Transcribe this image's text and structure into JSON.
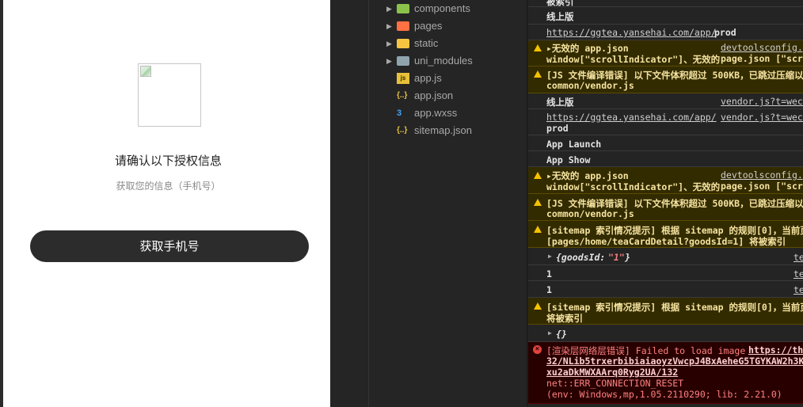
{
  "simulator": {
    "title": "请确认以下授权信息",
    "subtitle": "获取您的信息（手机号）",
    "button": "获取手机号"
  },
  "tree": [
    {
      "label": "components",
      "icon": "components-folder-icon",
      "arrow": "▶",
      "color": "#8bc34a"
    },
    {
      "label": "pages",
      "icon": "pages-folder-icon",
      "arrow": "▶",
      "color": "#ff7043"
    },
    {
      "label": "static",
      "icon": "static-folder-icon",
      "arrow": "▶",
      "color": "#f5c542"
    },
    {
      "label": "uni_modules",
      "icon": "folder-icon",
      "arrow": "▶",
      "color": "#90a4ae"
    },
    {
      "label": "app.js",
      "icon": "js-file-icon",
      "arrow": "",
      "color": "#e8c13a"
    },
    {
      "label": "app.json",
      "icon": "json-file-icon",
      "arrow": "",
      "color": "#e8c13a"
    },
    {
      "label": "app.wxss",
      "icon": "css-file-icon",
      "arrow": "",
      "color": "#42a5f5"
    },
    {
      "label": "sitemap.json",
      "icon": "json-file-icon",
      "arrow": "",
      "color": "#e8c13a"
    }
  ],
  "console": {
    "r0": "被索引",
    "r1": "线上版",
    "r2_link": "https://ggtea.yansehai.com/app/",
    "r2_text": "prod",
    "r3_a": "▸无效的 app.json",
    "r3_b": "window[\"scrollIndicator\"]、无效的",
    "r3_src1": "devtoolsconfig.j",
    "r3_src2": "page.json [\"scr",
    "r4_a": "[JS 文件编译错误] 以下文件体积超过 500KB，已跳过压缩以",
    "r4_b": "common/vendor.js",
    "r5": "线上版",
    "r5_src": "vendor.js?t=wech",
    "r6_link": "https://ggtea.yansehai.com/app/",
    "r6_text": "prod",
    "r6_src": "vendor.js?t=wech",
    "r7": "App Launch",
    "r8": "App Show",
    "r9_a": "▸无效的 app.json",
    "r9_b": "window[\"scrollIndicator\"]、无效的",
    "r9_src1": "devtoolsconfig.j",
    "r9_src2": "page.json [\"scr",
    "r10_a": "[JS 文件编译错误] 以下文件体积超过 500KB，已跳过压缩以",
    "r10_b": "common/vendor.js",
    "r11_a": "[sitemap 索引情况提示] 根据 sitemap 的规则[0]，当前页",
    "r11_b": "[pages/home/teaCardDetail?goodsId=1] 将被索引",
    "r12_key": "{goodsId: ",
    "r12_val": "\"1\"",
    "r12_end": "}",
    "r12_src": "te",
    "r13": "1",
    "r13_src": "te",
    "r14": "1",
    "r14_src": "te",
    "r15_a": "[sitemap 索引情况提示] 根据 sitemap 的规则[0]，当前页",
    "r15_b": "将被索引",
    "r16": "{}",
    "r17_a": "[渲染层网络层错误] Failed to load image",
    "r17_link": "https://thi",
    "r17_b": "32/NLib5trxerbibiaiaoyzVwcpJ4BxAeheG5TGYKAW2h3Kia",
    "r17_c": "xu2aDkMWXAArq0Ryg2UA/132",
    "r17_d": "net::ERR_CONNECTION_RESET",
    "r17_e": "(env: Windows,mp,1.05.2110290; lib: 2.21.0)"
  }
}
